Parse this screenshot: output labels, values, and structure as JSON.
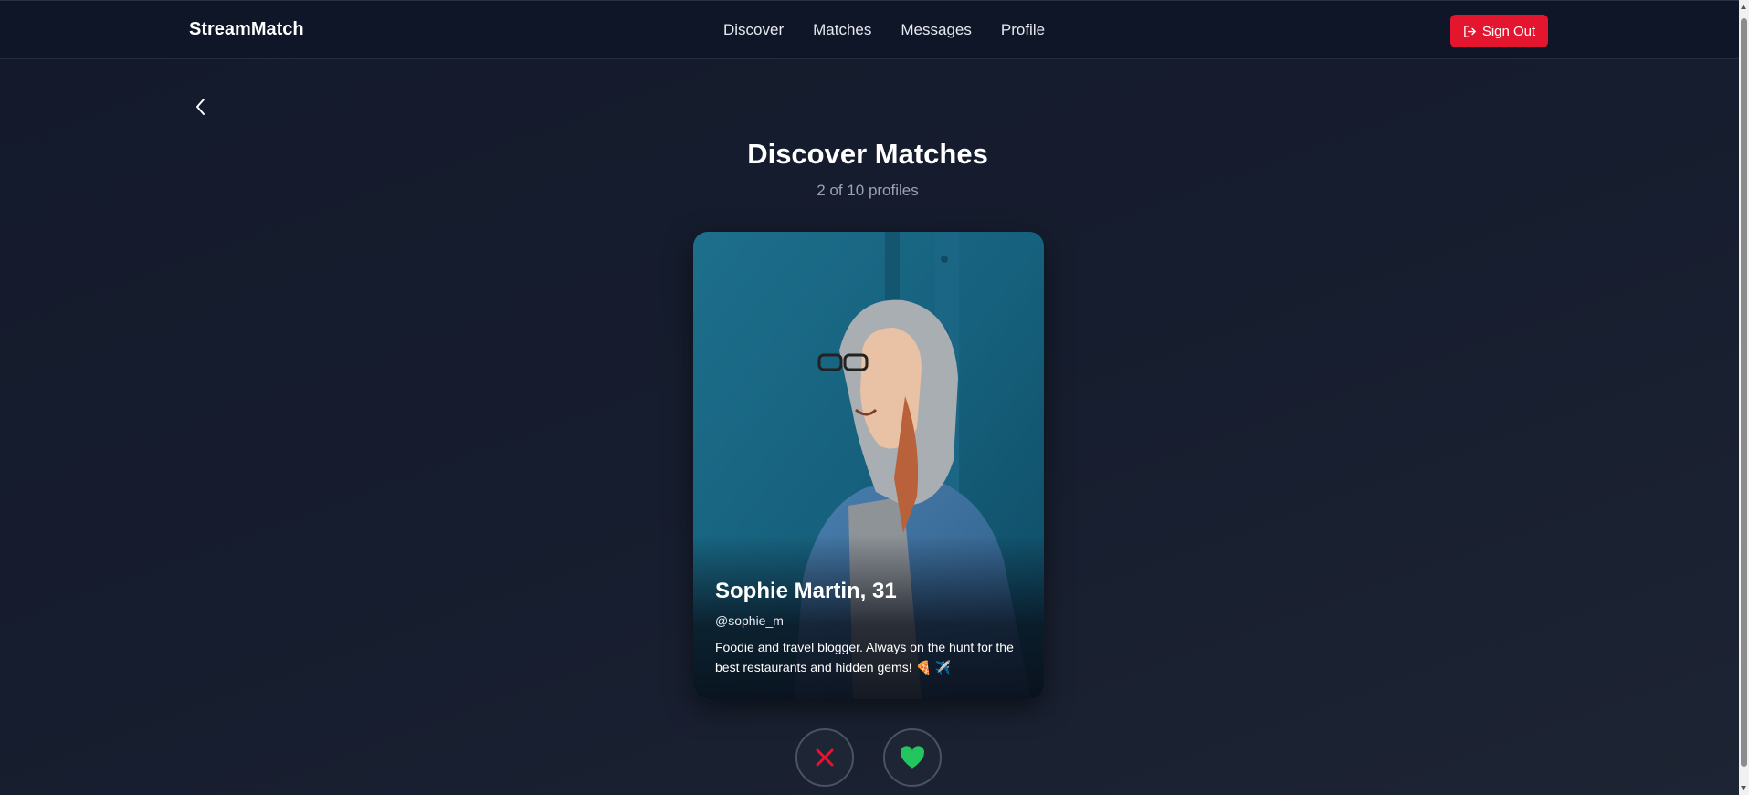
{
  "app": {
    "brand": "StreamMatch"
  },
  "nav": {
    "links": [
      "Discover",
      "Matches",
      "Messages",
      "Profile"
    ],
    "signout_label": "Sign Out"
  },
  "header": {
    "title": "Discover Matches",
    "subtitle": "2 of 10 profiles"
  },
  "profile": {
    "name_age": "Sophie Martin, 31",
    "handle": "@sophie_m",
    "bio": "Foodie and travel blogger. Always on the hunt for the best restaurants and hidden gems! 🍕 ✈️"
  },
  "actions": {
    "reject_icon": "x-icon",
    "like_icon": "heart-icon"
  },
  "colors": {
    "accent_red": "#e3152f",
    "like_green": "#22c55e",
    "reject_red": "#e3152f",
    "background": "#161d2e"
  }
}
